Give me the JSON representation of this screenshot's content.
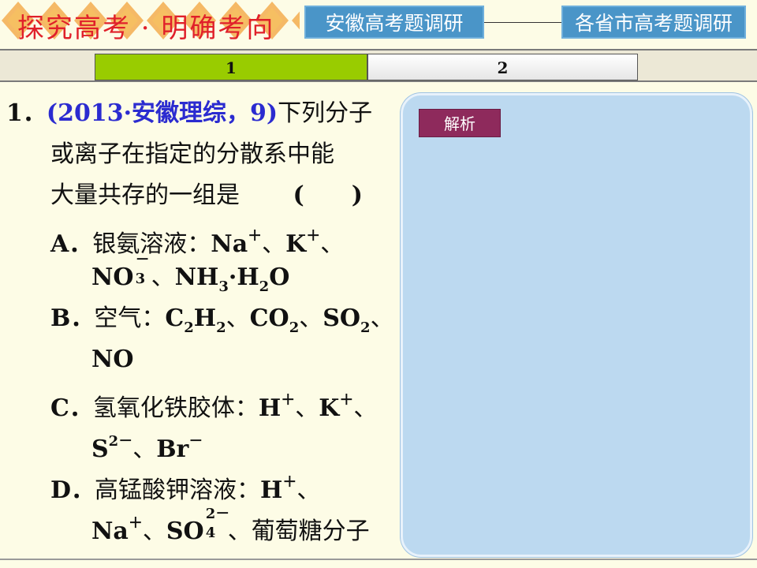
{
  "header": {
    "title": "探究高考 · 明确考向",
    "btn_anhui": "安徽高考题调研",
    "btn_provinces": "各省市高考题调研"
  },
  "tabs": [
    {
      "label": "1",
      "active": true
    },
    {
      "label": "2",
      "active": false
    }
  ],
  "question": {
    "number": "1．",
    "source": "(2013·安徽理综，9)",
    "stem_1": "下列分子",
    "stem_2": "或离子在指定的分散系中能",
    "stem_3": "大量共存的一组是",
    "bracket": "(　　)",
    "option_a": {
      "letter": "A．",
      "text": "银氨溶液："
    },
    "option_b": {
      "letter": "B．",
      "text": "空气："
    },
    "option_c": {
      "letter": "C．",
      "text": "氢氧化铁胶体："
    },
    "option_d": {
      "letter": "D．",
      "text": "高锰酸钾溶液："
    },
    "sep": "、",
    "glucose": "葡萄糖分子"
  },
  "panel": {
    "analysis_label": "解析"
  },
  "colors": {
    "title_red": "#e0202a",
    "header_button_blue": "#4a95c8",
    "tab_active_green": "#99cc00",
    "source_blue": "#2b2bd0",
    "panel_blue": "#bcd9f0",
    "analysis_button": "#8e2a5c",
    "background": "#fdfce6"
  }
}
